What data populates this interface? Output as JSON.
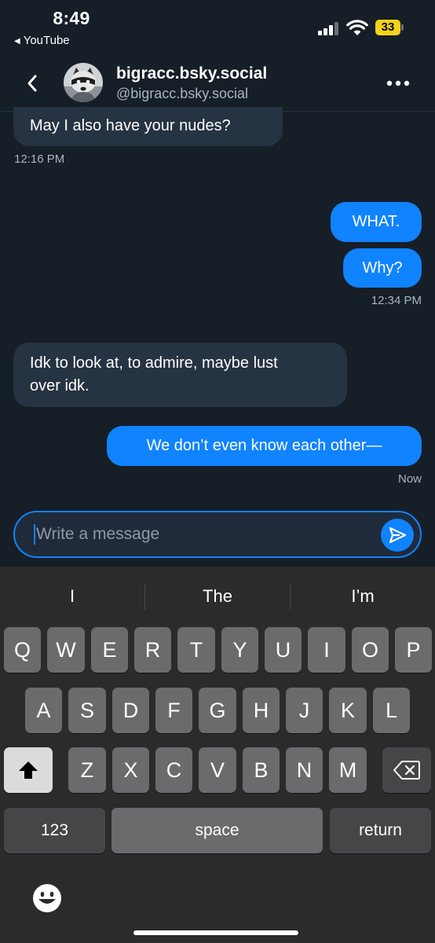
{
  "status_bar": {
    "time": "8:49",
    "back_app": "YouTube",
    "battery": "33",
    "colors": {
      "battery": "#f4d31a"
    }
  },
  "header": {
    "name": "bigracc.bsky.social",
    "handle": "@bigracc.bsky.social",
    "back_icon": "chevron-left-icon",
    "more_icon": "ellipsis-icon"
  },
  "messages": [
    {
      "from": "them",
      "text": "May I also have your nudes?"
    },
    {
      "type": "timestamp",
      "text": "12:16 PM"
    },
    {
      "from": "me",
      "text": "WHAT."
    },
    {
      "from": "me",
      "text": "Why?"
    },
    {
      "type": "timestamp",
      "text": "12:34 PM"
    },
    {
      "from": "them",
      "lines": [
        "Idk to look at, to admire, maybe lust",
        "over idk."
      ]
    },
    {
      "from": "me",
      "text": "We don’t even know each other—"
    },
    {
      "type": "timestamp",
      "text": "Now"
    }
  ],
  "composer": {
    "placeholder": "Write a message",
    "value": "",
    "send_icon": "send-icon"
  },
  "keyboard": {
    "suggestions": [
      "I",
      "The",
      "I’m"
    ],
    "row1": [
      "Q",
      "W",
      "E",
      "R",
      "T",
      "Y",
      "U",
      "I",
      "O",
      "P"
    ],
    "row2": [
      "A",
      "S",
      "D",
      "F",
      "G",
      "H",
      "J",
      "K",
      "L"
    ],
    "row3": [
      "Z",
      "X",
      "C",
      "V",
      "B",
      "N",
      "M"
    ],
    "numbers_label": "123",
    "space_label": "space",
    "return_label": "return",
    "shift_icon": "shift-icon",
    "delete_icon": "backspace-icon",
    "emoji_icon": "emoji-icon"
  },
  "colors": {
    "background": "#161e27",
    "incoming_bubble": "#263342",
    "outgoing_bubble": "#1083fe",
    "accent": "#1083fe",
    "secondary_text": "#aab4c1"
  }
}
